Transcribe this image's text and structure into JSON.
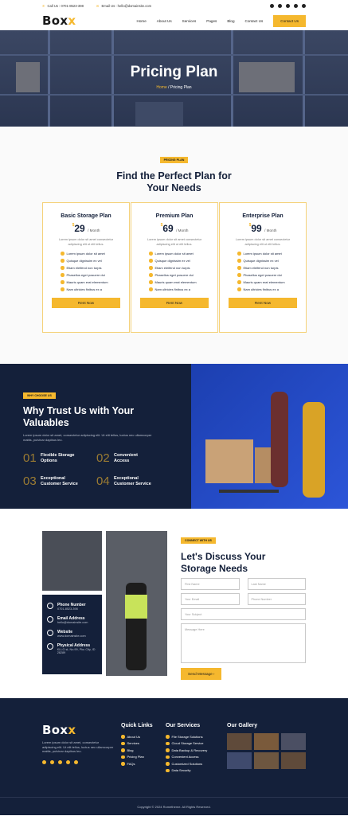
{
  "topbar": {
    "call": "Call Us : 0701-8523-398",
    "email": "Email Us : hello@domainsite.com"
  },
  "brand": {
    "logo_main": "Box",
    "logo_accent": "x"
  },
  "nav": {
    "items": [
      "Home",
      "About Us",
      "Services",
      "Pages",
      "Blog",
      "Contact Us"
    ],
    "cta": "Contact Us"
  },
  "hero": {
    "title": "Pricing Plan",
    "crumb_home": "Home",
    "crumb_sep": " / ",
    "crumb_current": "Pricing Plan"
  },
  "pricing": {
    "tag": "PRICING PLAN",
    "title_line1": "Find the Perfect Plan for",
    "title_line2": "Your Needs",
    "plans": [
      {
        "name": "Basic Storage Plan",
        "currency": "$",
        "price": "29",
        "period": "/ Month",
        "desc": "Lorem ipsum dolor sit amet consectetur adipiscing elit ut elit tellus.",
        "features": [
          "Lorem ipsum dolor sit amet",
          "Quisque dignissim ex vel",
          "Etiam eleifend non turpis",
          "Phasellus eget posuere dui",
          "Mauris quam erat elementum",
          "Nam ultricies finibus ex a"
        ],
        "button": "Rent Now"
      },
      {
        "name": "Premium Plan",
        "currency": "$",
        "price": "69",
        "period": "/ Month",
        "desc": "Lorem ipsum dolor sit amet consectetur adipiscing elit ut elit tellus.",
        "features": [
          "Lorem ipsum dolor sit amet",
          "Quisque dignissim ex vel",
          "Etiam eleifend non turpis",
          "Phasellus eget posuere dui",
          "Mauris quam erat elementum",
          "Nam ultricies finibus ex a"
        ],
        "button": "Rent Now"
      },
      {
        "name": "Enterprise Plan",
        "currency": "$",
        "price": "99",
        "period": "/ Month",
        "desc": "Lorem ipsum dolor sit amet consectetur adipiscing elit ut elit tellus.",
        "features": [
          "Lorem ipsum dolor sit amet",
          "Quisque dignissim ex vel",
          "Etiam eleifend non turpis",
          "Phasellus eget posuere dui",
          "Mauris quam erat elementum",
          "Nam ultricies finibus ex a"
        ],
        "button": "Rent Now"
      }
    ]
  },
  "trust": {
    "tag": "WHY CHOOSE US",
    "title_line1": "Why Trust Us with Your",
    "title_line2": "Valuables",
    "text": "Lorem ipsum dolor sit amet, consectetur adipiscing elit. Ut elit tellus, luctus nec ullamcorper mattis, pulvinar dapibus leo.",
    "items": [
      {
        "num": "01",
        "line1": "Flexible Storage",
        "line2": "Options"
      },
      {
        "num": "02",
        "line1": "Convenient",
        "line2": "Access"
      },
      {
        "num": "03",
        "line1": "Exceptional",
        "line2": "Customer Service"
      },
      {
        "num": "04",
        "line1": "Exceptional",
        "line2": "Customer Service"
      }
    ]
  },
  "contact": {
    "info": [
      {
        "label": "Phone Number",
        "value": "0701-8523-398",
        "icon": "phone-icon"
      },
      {
        "label": "Email Address",
        "value": "hello@domainsite.com",
        "icon": "email-icon"
      },
      {
        "label": "Website",
        "value": "www.domainsite.com",
        "icon": "globe-icon"
      },
      {
        "label": "Physical Address",
        "value": "KLLG st, No.99, Pku City, ID 28289",
        "icon": "location-icon"
      }
    ],
    "tag": "CONNECT WITH US",
    "title_line1": "Let's Discuss Your",
    "title_line2": "Storage Needs",
    "fields": {
      "first": "First Name",
      "last": "Last Name",
      "email": "Your Email",
      "phone": "Phone Number",
      "subject": "Your Subject",
      "message": "Message Here"
    },
    "submit": "Send Message"
  },
  "footer": {
    "about": "Lorem ipsum dolor sit amet, consectetur adipiscing elit. Ut elit tellus, luctus nec ullamcorper mattis, pulvinar dapibus leo.",
    "quick_title": "Quick Links",
    "quick_links": [
      "About Us",
      "Services",
      "Blog",
      "Pricing Plan",
      "FAQs"
    ],
    "services_title": "Our Services",
    "services": [
      "File Storage Solutions",
      "Cloud Storage Service",
      "Data Backup & Recovery",
      "Convenient Access",
      "Customized Solutions",
      "Data Security"
    ],
    "gallery_title": "Our Gallery",
    "copyright": "Copyright © 2024 Rometheme. All Rights Reserved."
  }
}
